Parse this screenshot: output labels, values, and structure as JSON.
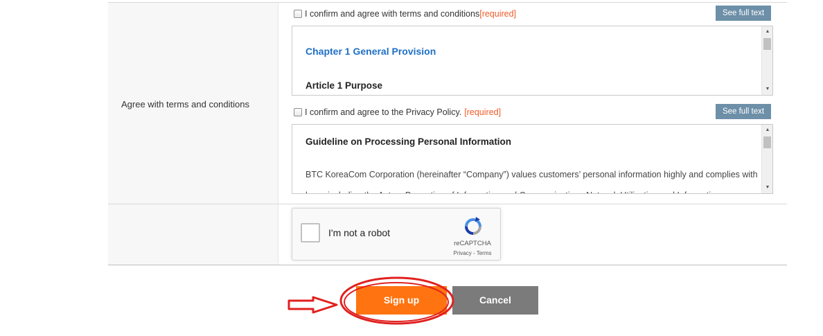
{
  "terms_section": {
    "label": "Agree with terms and conditions",
    "terms": {
      "checkbox_label": "I confirm and agree with terms and conditions",
      "required_tag": "[required]",
      "full_text_button": "See full text",
      "heading": "Chapter 1 General Provision",
      "subheading": "Article 1 Purpose"
    },
    "privacy": {
      "checkbox_label": "I confirm and agree to the Privacy Policy.",
      "required_tag": "[required]",
      "full_text_button": "See full text",
      "heading": "Guideline on Processing Personal Information",
      "body": "BTC KoreaCom Corporation (hereinafter “Company”) values customers’ personal information highly and complies with laws, including the Act on Promotion of Information and Communications Network Utilization and Information"
    }
  },
  "recaptcha": {
    "label": "I'm not a robot",
    "brand": "reCAPTCHA",
    "links": "Privacy - Terms"
  },
  "actions": {
    "signup": "Sign up",
    "cancel": "Cancel"
  },
  "colors": {
    "signup_bg": "#ff7410",
    "cancel_bg": "#7b7b7b",
    "full_text_bg": "#6d8fa8",
    "required": "#f05a28",
    "chapter_link": "#1f6fc5",
    "annotation": "#e0211f"
  }
}
